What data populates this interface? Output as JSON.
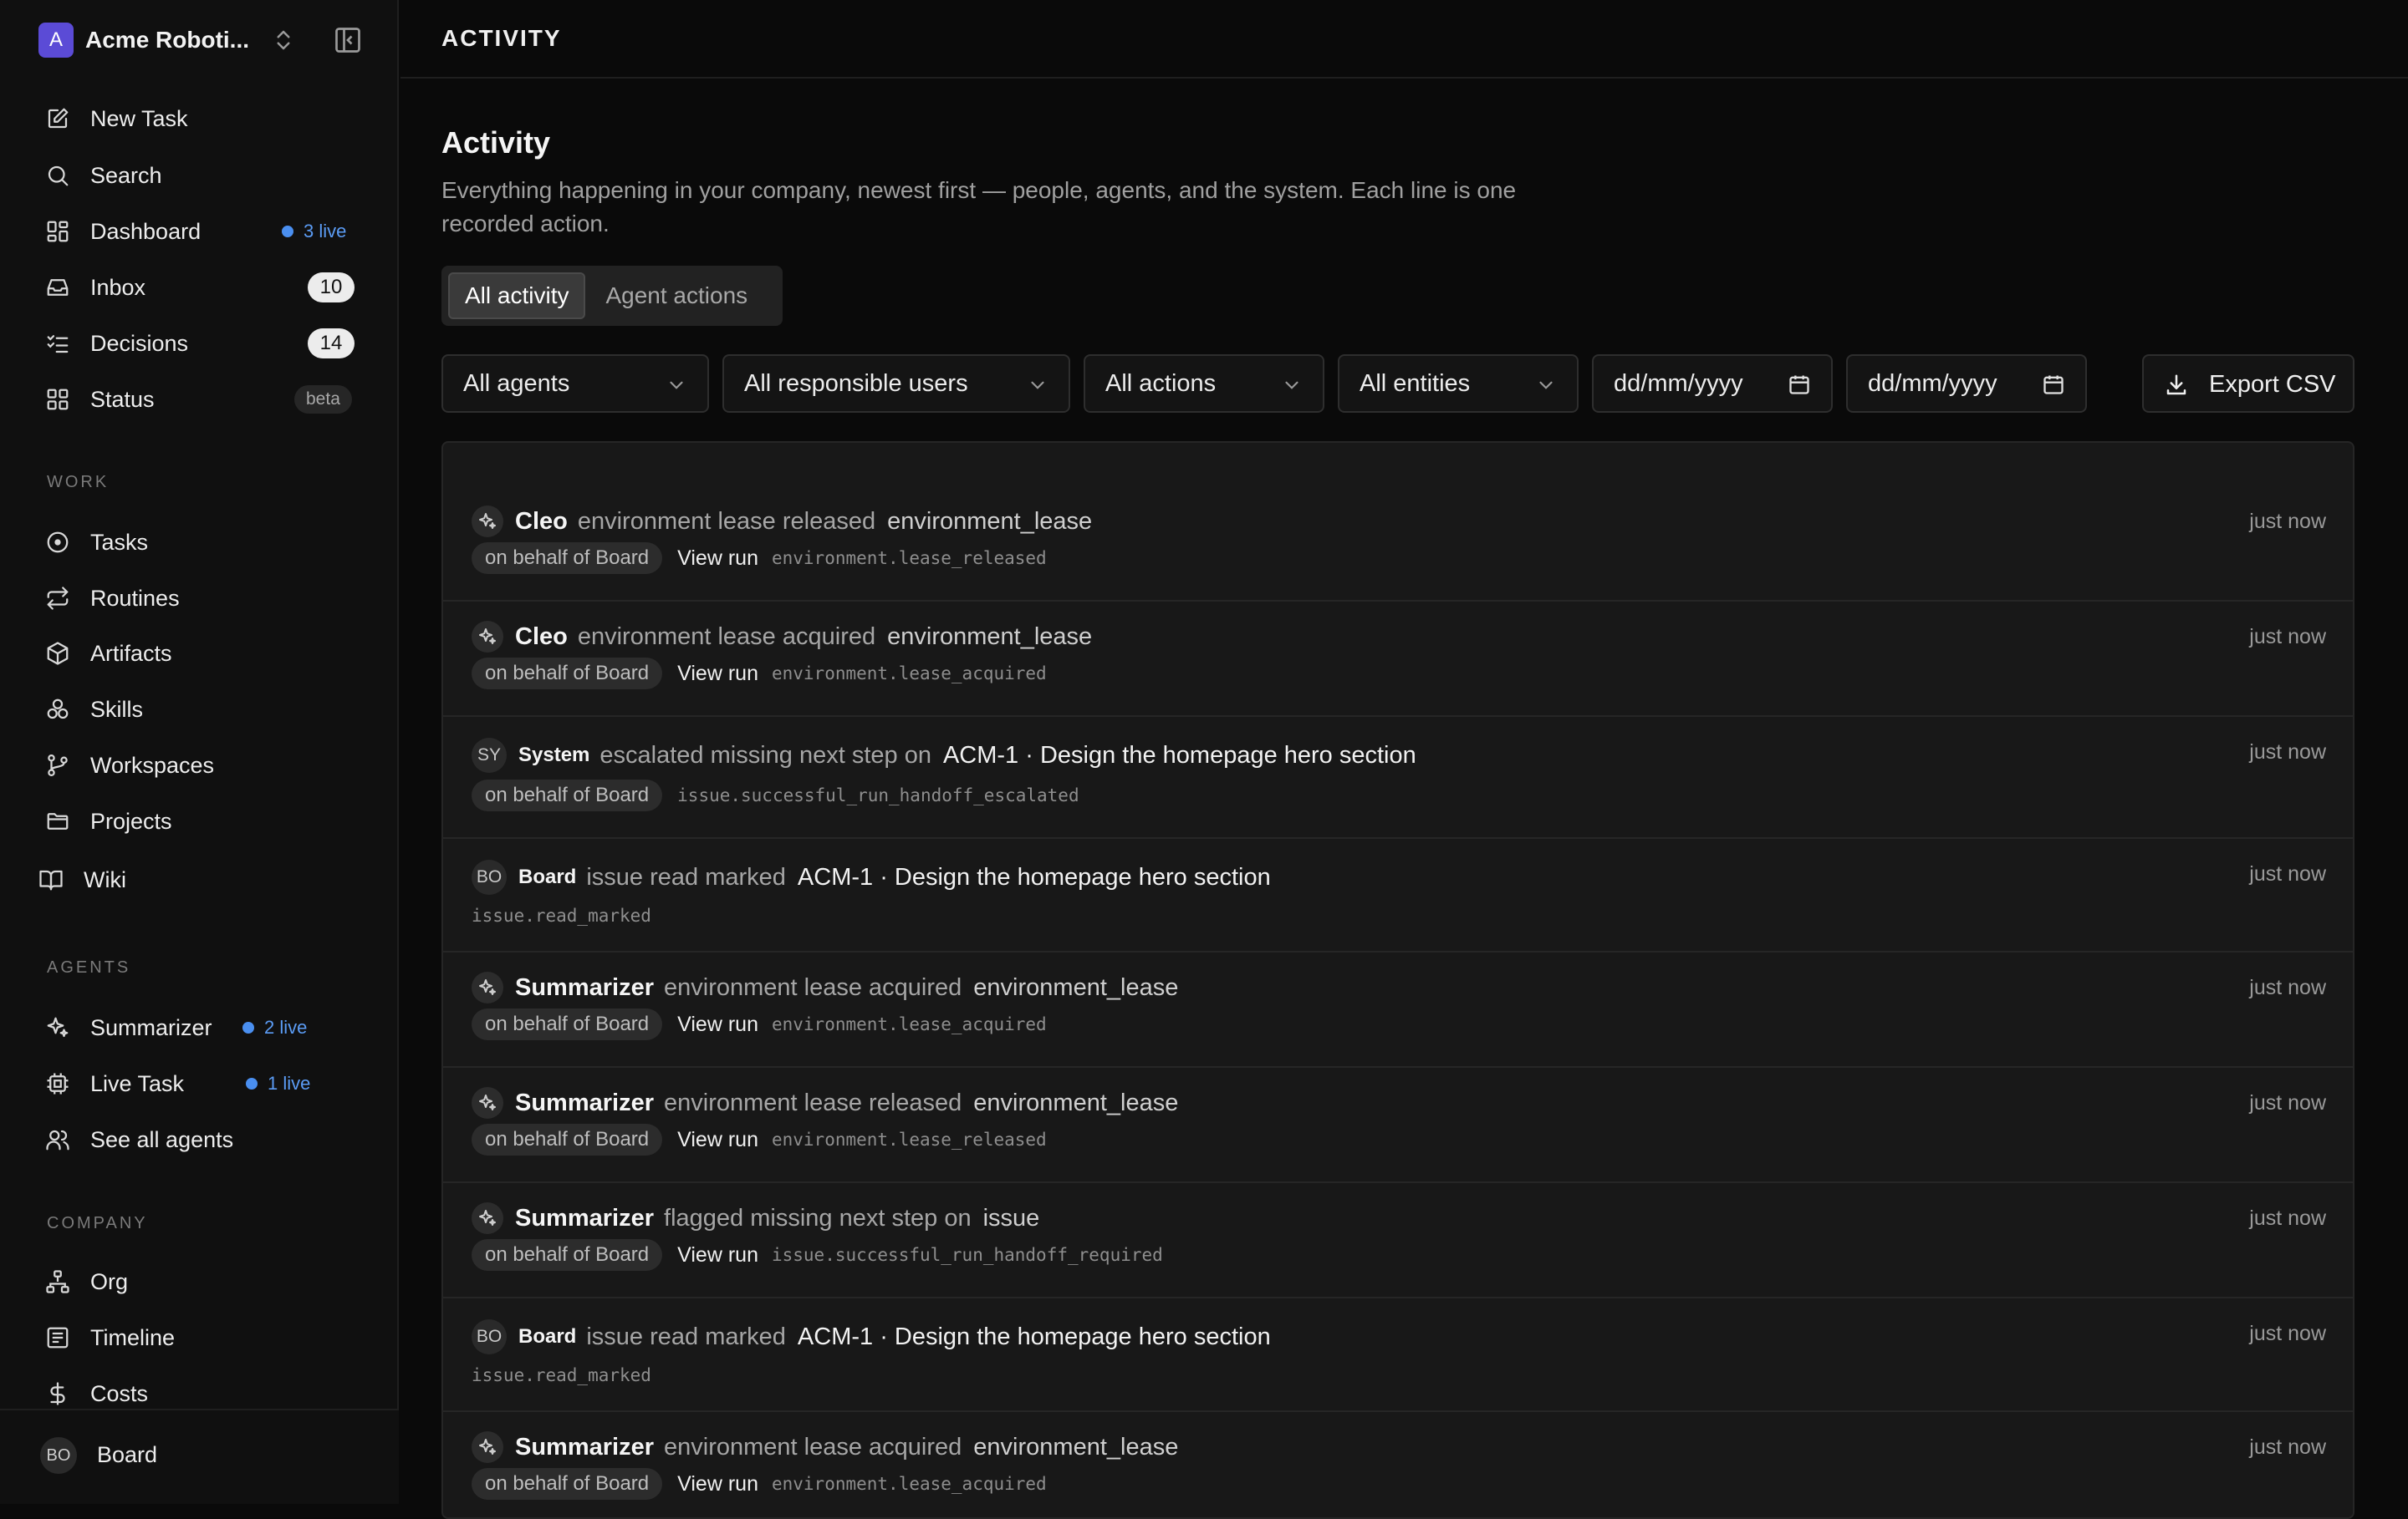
{
  "workspace": {
    "initial": "A",
    "name": "Acme Roboti..."
  },
  "nav": {
    "new_task": "New Task",
    "search": "Search",
    "dashboard": "Dashboard",
    "dashboard_live": "3 live",
    "inbox": "Inbox",
    "inbox_count": "10",
    "decisions": "Decisions",
    "decisions_count": "14",
    "status": "Status",
    "status_badge": "beta"
  },
  "work": {
    "section": "WORK",
    "tasks": "Tasks",
    "routines": "Routines",
    "artifacts": "Artifacts",
    "skills": "Skills",
    "workspaces": "Workspaces",
    "projects": "Projects",
    "wiki": "Wiki"
  },
  "agents": {
    "section": "AGENTS",
    "summarizer": "Summarizer",
    "summarizer_live": "2 live",
    "live_task": "Live Task",
    "live_task_live": "1 live",
    "see_all": "See all agents"
  },
  "company": {
    "section": "COMPANY",
    "org": "Org",
    "timeline": "Timeline",
    "costs": "Costs"
  },
  "user": {
    "initials": "BO",
    "name": "Board"
  },
  "topbar": {
    "title": "ACTIVITY"
  },
  "page": {
    "title": "Activity",
    "description": "Everything happening in your company, newest first — people, agents, and the system. Each line is one recorded action."
  },
  "tabs": {
    "all_activity": "All activity",
    "agent_actions": "Agent actions"
  },
  "filters": {
    "agents": "All agents",
    "users": "All responsible users",
    "actions": "All actions",
    "entities": "All entities",
    "date_from": "dd/mm/yyyy",
    "date_to": "dd/mm/yyyy",
    "export": "Export CSV"
  },
  "activity": [
    {
      "actor": "Cleo",
      "action": "environment lease released",
      "entity": "environment_lease",
      "behalf": "on behalf of Board",
      "view_run": "View run",
      "code": "environment.lease_released",
      "time": "just now"
    },
    {
      "actor": "Cleo",
      "action": "environment lease acquired",
      "entity": "environment_lease",
      "behalf": "on behalf of Board",
      "view_run": "View run",
      "code": "environment.lease_acquired",
      "time": "just now"
    },
    {
      "initials": "SY",
      "actor": "System",
      "action": "escalated missing next step on",
      "entity": "ACM-1 · Design the homepage hero section",
      "behalf": "on behalf of Board",
      "code": "issue.successful_run_handoff_escalated",
      "time": "just now"
    },
    {
      "initials": "BO",
      "actor": "Board",
      "action": "issue read marked",
      "entity": "ACM-1 · Design the homepage hero section",
      "code": "issue.read_marked",
      "time": "just now"
    },
    {
      "actor": "Summarizer",
      "action": "environment lease acquired",
      "entity": "environment_lease",
      "behalf": "on behalf of Board",
      "view_run": "View run",
      "code": "environment.lease_acquired",
      "time": "just now"
    },
    {
      "actor": "Summarizer",
      "action": "environment lease released",
      "entity": "environment_lease",
      "behalf": "on behalf of Board",
      "view_run": "View run",
      "code": "environment.lease_released",
      "time": "just now"
    },
    {
      "actor": "Summarizer",
      "action": "flagged missing next step on",
      "entity": "issue",
      "behalf": "on behalf of Board",
      "view_run": "View run",
      "code": "issue.successful_run_handoff_required",
      "time": "just now"
    },
    {
      "initials": "BO",
      "actor": "Board",
      "action": "issue read marked",
      "entity": "ACM-1 · Design the homepage hero section",
      "code": "issue.read_marked",
      "time": "just now"
    },
    {
      "actor": "Summarizer",
      "action": "environment lease acquired",
      "entity": "environment_lease",
      "behalf": "on behalf of Board",
      "view_run": "View run",
      "code": "environment.lease_acquired",
      "time": "just now"
    }
  ]
}
